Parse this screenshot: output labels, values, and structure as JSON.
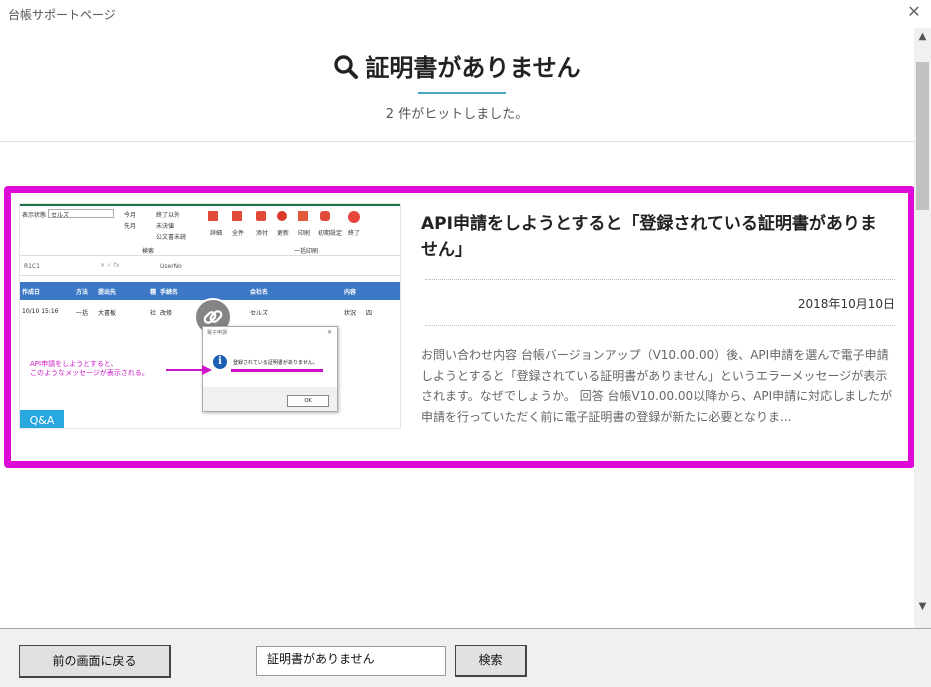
{
  "window": {
    "title": "台帳サポートページ"
  },
  "search": {
    "heading": "証明書がありません",
    "hits": "2 件がヒットしました。"
  },
  "result": {
    "title": "API申請をしようとすると「登録されている証明書がありません」",
    "date": "2018年10月10日",
    "excerpt": "お問い合わせ内容 台帳バージョンアップ（V10.00.00）後、API申請を選んで電子申請しようとすると「登録されている証明書がありません」というエラーメッセージが表示されます。なぜでしょうか。 回答 台帳V10.00.00以降から、API申請に対応しましたが申請を行っていただく前に電子証明書の登録が新たに必要となりま...",
    "badge": "Q&A",
    "thumbnail": {
      "annotation_line1": "API申請をしようとすると、",
      "annotation_line2": "このようなメッセージが表示される。",
      "dialog_message": "登録されている証明書がありません。",
      "dialog_ok": "OK",
      "dialog_title": "電子申請",
      "cell_ref": "R1C1",
      "formula_value": "UserNo",
      "col_headers": [
        "作成日",
        "方法",
        "提出先",
        "種",
        "手続名",
        "会社名",
        "内容"
      ],
      "row_values": [
        "10/10 15:16",
        "一括",
        "大書板",
        "社",
        "改修",
        "セルズ",
        "状況",
        "四"
      ],
      "ribbon_group1": [
        "今月",
        "先月"
      ],
      "ribbon_group2": [
        "終了以外",
        "未決値",
        "公文書未読"
      ],
      "ribbon_buttons": [
        "詳細",
        "全件",
        "添付",
        "更新",
        "印刷",
        "初期設定",
        "終了"
      ],
      "ribbon_label_left": "検索",
      "ribbon_label_right": "一括印刷",
      "display_state": "表示状態",
      "display_value": "セルズ"
    }
  },
  "bottom": {
    "back_label": "前の画面に戻る",
    "search_value": "証明書がありません",
    "search_label": "検索"
  },
  "colors": {
    "highlight_border": "#e00ad8",
    "accent": "#49a6c8",
    "badge": "#29a8e0"
  }
}
